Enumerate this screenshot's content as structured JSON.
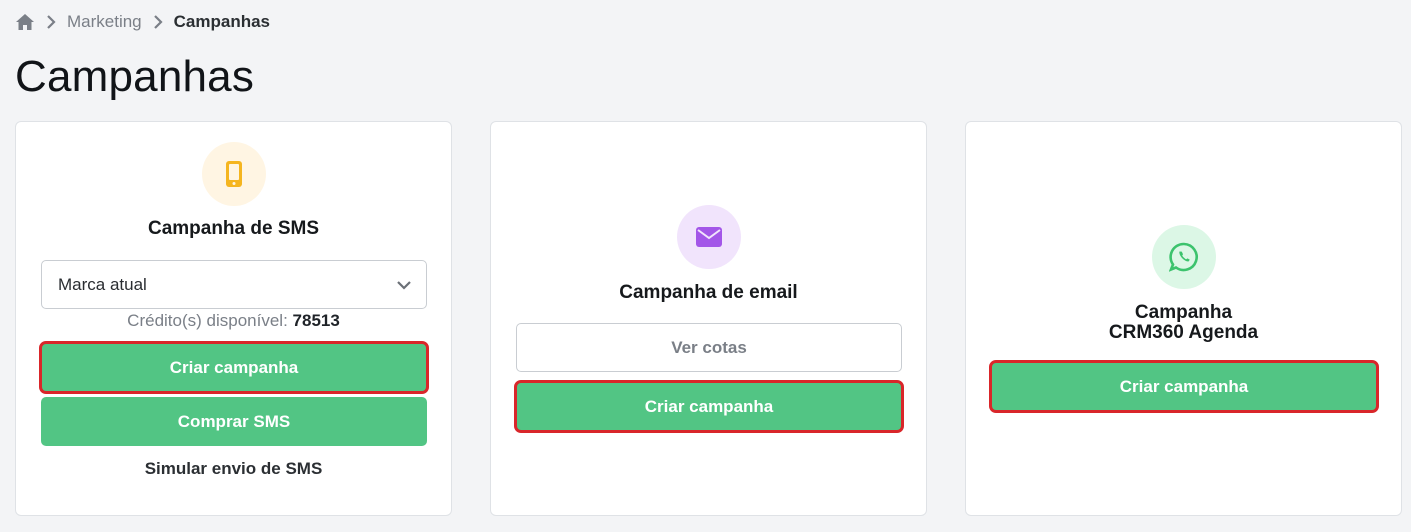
{
  "breadcrumb": {
    "items": [
      {
        "label": "Marketing"
      },
      {
        "label": "Campanhas"
      }
    ]
  },
  "page_title": "Campanhas",
  "cards": {
    "sms": {
      "title": "Campanha de SMS",
      "select_value": "Marca atual",
      "credits_label": "Crédito(s) disponível:",
      "credits_value": "78513",
      "create_label": "Criar campanha",
      "buy_label": "Comprar SMS",
      "simulate_label": "Simular envio de SMS",
      "icon": "phone-icon"
    },
    "email": {
      "title": "Campanha de email",
      "quota_label": "Ver cotas",
      "create_label": "Criar campanha",
      "icon": "envelope-icon"
    },
    "whatsapp": {
      "title_line1": "Campanha",
      "title_line2": "CRM360 Agenda",
      "create_label": "Criar campanha",
      "icon": "whatsapp-icon"
    }
  },
  "colors": {
    "primary_green": "#52c584",
    "highlight_red": "#d9262a",
    "sms_icon_bg": "#fff5e3",
    "sms_icon": "#f5b51f",
    "email_icon_bg": "#f1e4fc",
    "email_icon": "#a356e8",
    "whatsapp_icon_bg": "#dcf7e6",
    "whatsapp_icon": "#3cc36d"
  }
}
